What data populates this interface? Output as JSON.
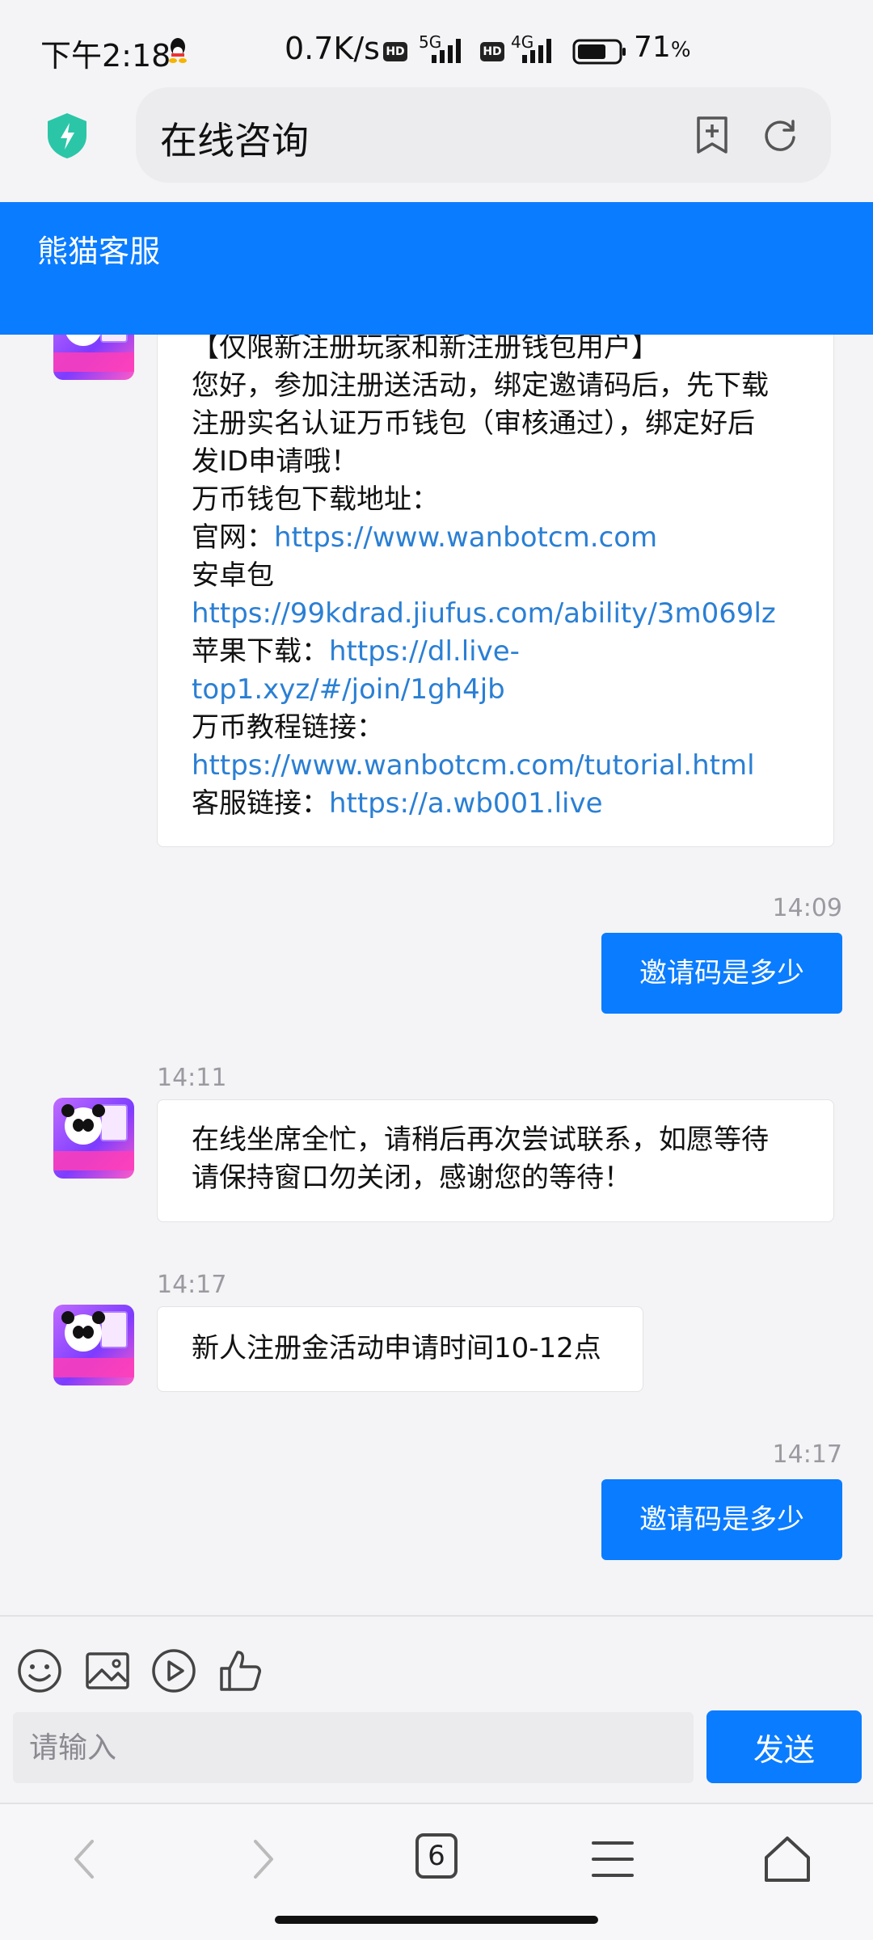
{
  "status_bar": {
    "time": "下午2:18",
    "speed": "0.7K/s",
    "network1": "5G",
    "network2": "4G",
    "hd": "HD",
    "battery": "71",
    "battery_unit": "%"
  },
  "browser": {
    "page_title": "在线咨询"
  },
  "chat": {
    "agent_name": "熊猫客服",
    "messages": [
      {
        "lines": [
          "【仅限新注册玩家和新注册钱包用户】",
          "您好，参加注册送活动，绑定邀请码后，先下载",
          "注册实名认证万币钱包（审核通过），绑定好后",
          "发ID申请哦！",
          "万币钱包下载地址："
        ],
        "official_label": "官网：",
        "official_url": "https://www.wanbotcm.com",
        "android_label": "安卓包",
        "android_url": "https://99kdrad.jiufus.com/ability/3m069lz",
        "apple_label": "苹果下载：",
        "apple_url_1": "https://dl.live-",
        "apple_url_2": "top1.xyz/#/join/1gh4jb",
        "tutorial_label": "万币教程链接：",
        "tutorial_url": "https://www.wanbotcm.com/tutorial.html",
        "service_label": "客服链接：",
        "service_url": "https://a.wb001.live"
      },
      {
        "time": "14:09",
        "text": "邀请码是多少"
      },
      {
        "time": "14:11",
        "text_1": "在线坐席全忙，请稍后再次尝试联系，如愿等待",
        "text_2": "请保持窗口勿关闭，感谢您的等待！"
      },
      {
        "time": "14:17",
        "text": "新人注册金活动申请时间10-12点"
      },
      {
        "time": "14:17",
        "text": "邀请码是多少"
      }
    ]
  },
  "input": {
    "placeholder": "请输入",
    "send_label": "发送"
  },
  "nav": {
    "tab_count": "6"
  },
  "colors": {
    "accent": "#0a7cff",
    "link": "#2a7fd4"
  }
}
